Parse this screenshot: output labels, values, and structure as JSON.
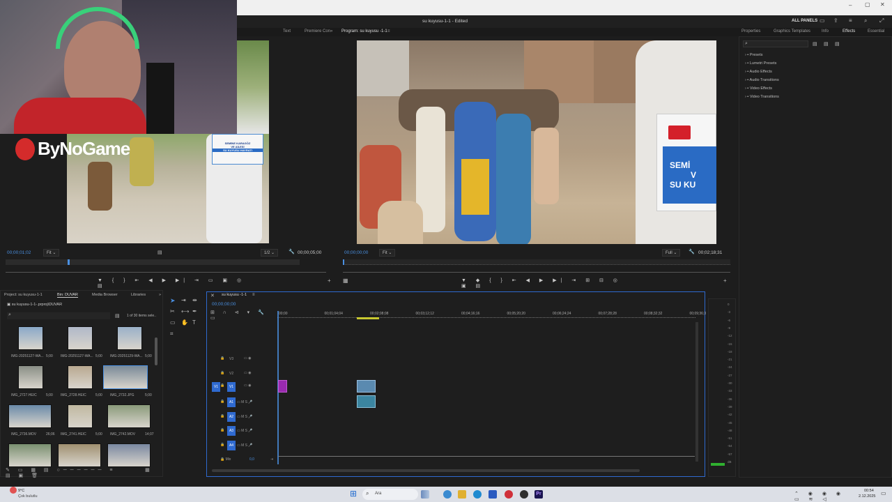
{
  "webcam": {
    "logo_text": "ByNoGame"
  },
  "app": {
    "project_title": "su kuyusu-1-1 - Edited",
    "all_panels": "ALL PANELS"
  },
  "source_tabs": [
    "Text",
    "Premiere Con"
  ],
  "program": {
    "label": "Program: su kuyusu -1-1",
    "timecode": "00;00;00;00",
    "fit": "Fit",
    "quality": "Full",
    "duration": "00;02;18;31"
  },
  "source": {
    "timecode": "00;00;01;02",
    "fit": "Fit",
    "fraction": "1/2",
    "duration": "00;00;05;00"
  },
  "right_tabs": [
    "Properties",
    "Graphics Templates",
    "Info",
    "Effects",
    "Essential"
  ],
  "effects_list": [
    "Presets",
    "Lumetri Presets",
    "Audio Effects",
    "Audio Transitions",
    "Video Effects",
    "Video Transitions"
  ],
  "project": {
    "tabs": [
      "Project: su kuyusu-1-1",
      "Bin: DUVAR",
      "Media Browser",
      "Libraries"
    ],
    "path": "su kuyusu-1-1-.prproj\\DUVAR",
    "selection": "1 of 30 items sele..",
    "items": [
      {
        "name": "IMG-20251127-WA...",
        "dur": "5;00"
      },
      {
        "name": "IMG-20251127-WA...",
        "dur": "5;00"
      },
      {
        "name": "IMG-20251129-WA...",
        "dur": "5;00"
      },
      {
        "name": "IMG_2727.HEIC",
        "dur": "5;00"
      },
      {
        "name": "IMG_2728.HEIC",
        "dur": "5;00"
      },
      {
        "name": "IMG_2732.JPG",
        "dur": "5;00"
      },
      {
        "name": "IMG_2736.MOV",
        "dur": "26;06"
      },
      {
        "name": "IMG_2741.HEIC",
        "dur": "5;00"
      },
      {
        "name": "IMG_2742.MOV",
        "dur": "14;07"
      },
      {
        "name": "",
        "dur": ""
      },
      {
        "name": "",
        "dur": ""
      },
      {
        "name": "",
        "dur": ""
      }
    ]
  },
  "timeline": {
    "tab": "su kuyusu -1-1",
    "timecode": "00;00;00;00",
    "ruler": [
      "00;00",
      "00;01;04;04",
      "00;02;08;08",
      "00;03;12;12",
      "00;04;16;16",
      "00;05;20;20",
      "00;06;24;24",
      "00;07;28;28",
      "00;08;32;32",
      "00;09;36;3"
    ],
    "video_tracks": [
      "V3",
      "V2",
      "V1"
    ],
    "audio_tracks": [
      "A1",
      "A2",
      "A3",
      "A4"
    ],
    "mix_label": "Mix",
    "mix_value": "0,0"
  },
  "meter_marks": [
    "0",
    "-3",
    "-6",
    "-9",
    "-12",
    "-15",
    "-18",
    "-21",
    "-24",
    "-27",
    "-30",
    "-33",
    "-36",
    "-39",
    "-42",
    "-45",
    "-48",
    "-51",
    "-54",
    "-57",
    "dB"
  ],
  "taskbar": {
    "weather_temp": "9°C",
    "weather_desc": "Çok bulutlu",
    "search": "Ara",
    "time": "00:54",
    "date": "2.12.2025"
  },
  "sign_text": {
    "line1": "SEMİNE KARAGÖZ",
    "line2": "VE AİLESİ",
    "line3": "SU KUYUSU HAYRATI",
    "program_line1": "SEMİ",
    "program_line2": "V",
    "program_line3": "SU KU"
  }
}
